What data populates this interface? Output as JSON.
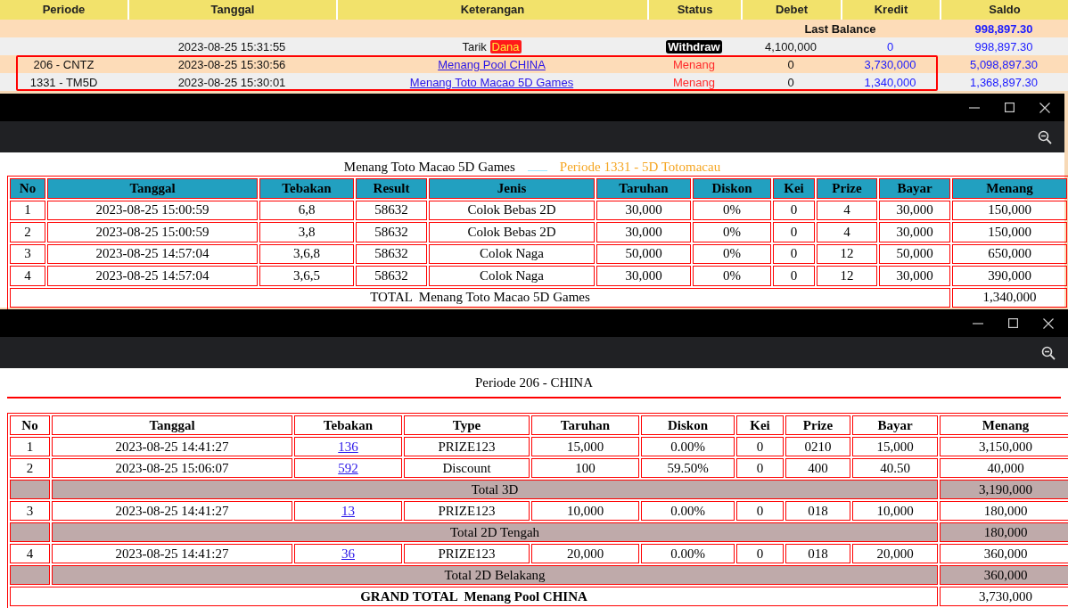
{
  "ledger": {
    "columns": [
      "Periode",
      "Tanggal",
      "Keterangan",
      "Status",
      "Debet",
      "Kredit",
      "Saldo"
    ],
    "last_balance": {
      "label": "Last Balance",
      "saldo": "998,897.30"
    },
    "rows": [
      {
        "tanggal": "2023-08-25 15:31:55",
        "keterangan": "Tarik",
        "badge": "Dana",
        "status": "Withdraw",
        "kind": "withdraw",
        "debet": "4,100,000",
        "kredit": "0",
        "saldo": "998,897.30",
        "highlighted": false
      },
      {
        "periode": "206 - CNTZ",
        "tanggal": "2023-08-25 15:30:56",
        "keterangan": "Menang Pool CHINA",
        "status": "Menang",
        "kind": "win",
        "debet": "0",
        "kredit": "3,730,000",
        "saldo": "5,098,897.30",
        "highlighted": true
      },
      {
        "periode": "1331 - TM5D",
        "tanggal": "2023-08-25 15:30:01",
        "keterangan": "Menang Toto Macao 5D Games",
        "status": "Menang",
        "kind": "win",
        "debet": "0",
        "kredit": "1,340,000",
        "saldo": "1,368,897.30",
        "highlighted": true
      }
    ]
  },
  "windows": [
    {
      "kind": "toto",
      "caption": "Menang Toto Macao 5D Games",
      "subcaption": "Periode 1331 - 5D Totomacau",
      "columns": [
        "No",
        "Tanggal",
        "Tebakan",
        "Result",
        "Jenis",
        "Taruhan",
        "Diskon",
        "Kei",
        "Prize",
        "Bayar",
        "Menang"
      ],
      "rows": [
        {
          "kind": "bet",
          "tebakan_link": false,
          "cells": [
            "1",
            "2023-08-25 15:00:59",
            "6,8",
            "58632",
            "Colok Bebas 2D",
            "30,000",
            "0%",
            "0",
            "4",
            "30,000",
            "150,000"
          ]
        },
        {
          "kind": "bet",
          "tebakan_link": false,
          "cells": [
            "2",
            "2023-08-25 15:00:59",
            "3,8",
            "58632",
            "Colok Bebas 2D",
            "30,000",
            "0%",
            "0",
            "4",
            "30,000",
            "150,000"
          ]
        },
        {
          "kind": "bet",
          "tebakan_link": false,
          "cells": [
            "3",
            "2023-08-25 14:57:04",
            "3,6,8",
            "58632",
            "Colok Naga",
            "50,000",
            "0%",
            "0",
            "12",
            "50,000",
            "650,000"
          ]
        },
        {
          "kind": "bet",
          "tebakan_link": false,
          "cells": [
            "4",
            "2023-08-25 14:57:04",
            "3,6,5",
            "58632",
            "Colok Naga",
            "30,000",
            "0%",
            "0",
            "12",
            "30,000",
            "390,000"
          ]
        },
        {
          "kind": "total",
          "label": "TOTAL  Menang Toto Macao 5D Games",
          "value": "1,340,000"
        }
      ]
    },
    {
      "kind": "pool",
      "caption": "Periode 206 - CHINA",
      "columns": [
        "No",
        "Tanggal",
        "Tebakan",
        "Type",
        "Taruhan",
        "Diskon",
        "Kei",
        "Prize",
        "Bayar",
        "Menang"
      ],
      "rows": [
        {
          "kind": "bet",
          "tebakan_link": true,
          "cells": [
            "1",
            "2023-08-25 14:41:27",
            "136",
            "PRIZE123",
            "15,000",
            "0.00%",
            "0",
            "0210",
            "15,000",
            "3,150,000"
          ]
        },
        {
          "kind": "bet",
          "tebakan_link": true,
          "cells": [
            "2",
            "2023-08-25 15:06:07",
            "592",
            "Discount",
            "100",
            "59.50%",
            "0",
            "400",
            "40.50",
            "40,000"
          ]
        },
        {
          "kind": "subtotal",
          "label": "Total 3D",
          "value": "3,190,000"
        },
        {
          "kind": "bet",
          "tebakan_link": true,
          "cells": [
            "3",
            "2023-08-25 14:41:27",
            "13",
            "PRIZE123",
            "10,000",
            "0.00%",
            "0",
            "018",
            "10,000",
            "180,000"
          ]
        },
        {
          "kind": "subtotal",
          "label": "Total 2D Tengah",
          "value": "180,000"
        },
        {
          "kind": "bet",
          "tebakan_link": true,
          "cells": [
            "4",
            "2023-08-25 14:41:27",
            "36",
            "PRIZE123",
            "20,000",
            "0.00%",
            "0",
            "018",
            "20,000",
            "360,000"
          ]
        },
        {
          "kind": "subtotal",
          "label": "Total 2D Belakang",
          "value": "360,000"
        },
        {
          "kind": "grand_total",
          "label": "GRAND TOTAL  Menang Pool CHINA",
          "value": "3,730,000"
        }
      ]
    }
  ]
}
